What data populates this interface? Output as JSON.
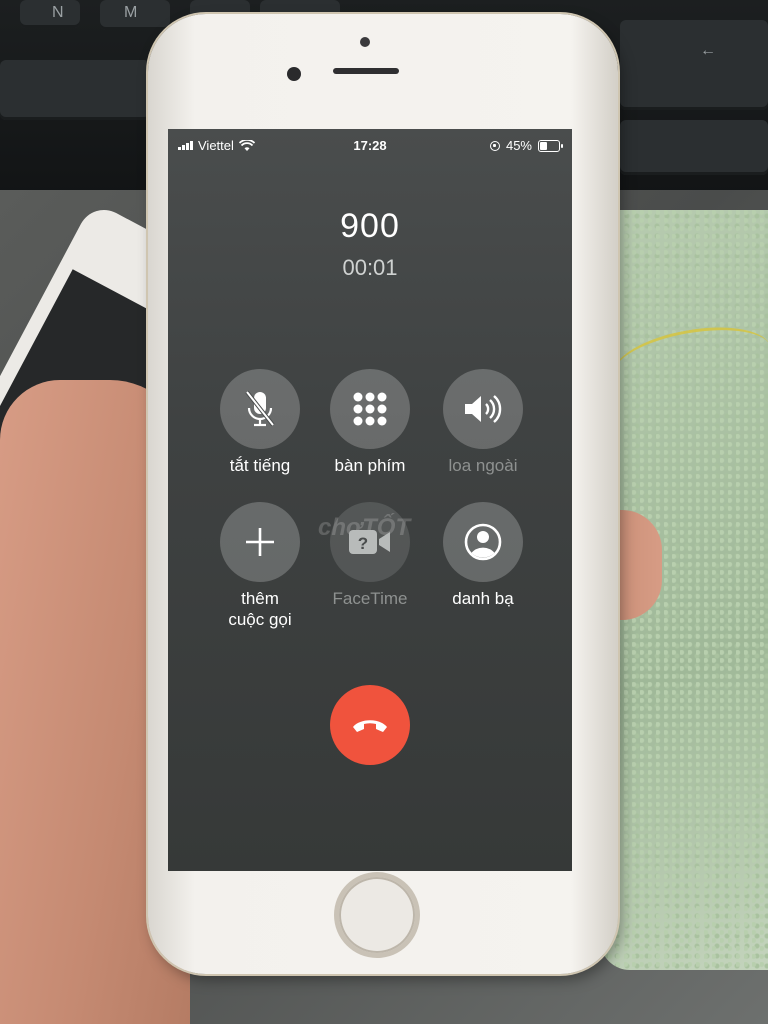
{
  "status_bar": {
    "carrier": "Viettel",
    "time": "17:28",
    "battery_percent": "45%",
    "battery_level": 0.45
  },
  "call": {
    "number": "900",
    "duration": "00:01"
  },
  "buttons": {
    "mute": "tắt tiếng",
    "keypad": "bàn phím",
    "speaker": "loa ngoài",
    "add_call_line1": "thêm",
    "add_call_line2": "cuộc gọi",
    "facetime": "FaceTime",
    "contacts": "danh bạ"
  },
  "watermark": "chợTỐT",
  "colors": {
    "end_call": "#f0533d",
    "button_bg": "rgba(255,255,255,0.22)"
  },
  "icons": [
    "wifi-icon",
    "rotation-lock-icon",
    "battery-icon",
    "mute-mic-icon",
    "keypad-icon",
    "speaker-icon",
    "plus-icon",
    "facetime-icon",
    "contacts-icon",
    "end-call-icon"
  ]
}
